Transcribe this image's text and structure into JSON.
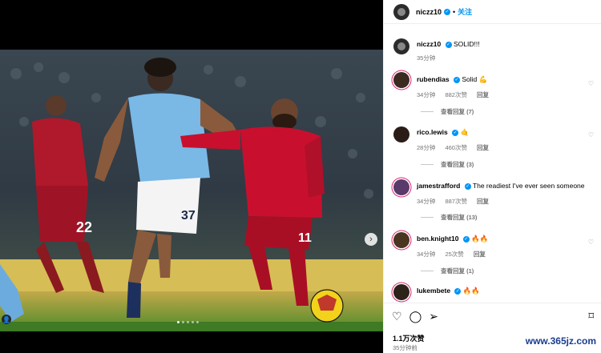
{
  "post": {
    "author": "niczz10",
    "follow_label": "关注",
    "caption_author": "niczz10",
    "caption_text": "SOLID!!!",
    "caption_time": "35分钟",
    "image_alt": "Manchester City and Liverpool players chasing the ball",
    "jersey_numbers": [
      "37",
      "11",
      "22"
    ],
    "carousel": {
      "slides": 5,
      "current": 1
    }
  },
  "comments": [
    {
      "user": "rubendias",
      "text": "Solid",
      "emoji": "💪",
      "time": "34分钟",
      "likes": "882次赞",
      "reply": "回复",
      "view_replies": "查看回复 (7)"
    },
    {
      "user": "rico.lewis",
      "text": "",
      "emoji": "🤙",
      "time": "28分钟",
      "likes": "460次赞",
      "reply": "回复",
      "view_replies": "查看回复 (3)"
    },
    {
      "user": "jamestrafford",
      "text": "The readiest I've ever seen someone",
      "emoji": "",
      "time": "34分钟",
      "likes": "887次赞",
      "reply": "回复",
      "view_replies": "查看回复 (13)"
    },
    {
      "user": "ben.knight10",
      "text": "",
      "emoji": "🔥🔥",
      "time": "34分钟",
      "likes": "25次赞",
      "reply": "回复",
      "view_replies": "查看回复 (1)"
    },
    {
      "user": "lukembete",
      "text": "",
      "emoji": "🔥🔥",
      "time": "",
      "likes": "",
      "reply": "",
      "view_replies": ""
    }
  ],
  "footer": {
    "likes": "1.1万次赞",
    "time": "35分钟前"
  },
  "watermark": "www.365jz.com",
  "colors": {
    "verified": "#0095f6",
    "follow": "#0095f6",
    "man_city": "#6cabdd",
    "liverpool": "#c8102e"
  }
}
